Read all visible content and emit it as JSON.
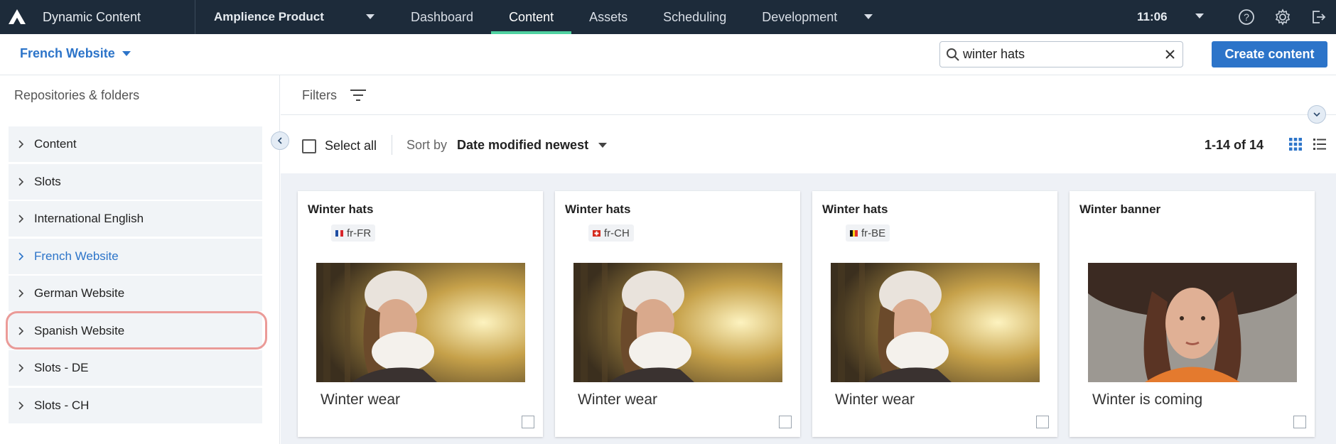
{
  "topbar": {
    "app_title": "Dynamic Content",
    "hub_name": "Amplience Product",
    "nav": [
      "Dashboard",
      "Content",
      "Assets",
      "Scheduling",
      "Development"
    ],
    "active_nav": "Content",
    "time": "11:06",
    "icons": [
      "amplience-logo-icon",
      "help-icon",
      "settings-gear-icon",
      "logout-icon"
    ]
  },
  "subbar": {
    "hub_select": "French Website",
    "search_value": "winter hats",
    "create_label": "Create content"
  },
  "sidebar": {
    "heading": "Repositories & folders",
    "items": [
      {
        "label": "Content"
      },
      {
        "label": "Slots"
      },
      {
        "label": "International English"
      },
      {
        "label": "French Website"
      },
      {
        "label": "German Website"
      },
      {
        "label": "Spanish Website"
      },
      {
        "label": "Slots - DE"
      },
      {
        "label": "Slots - CH"
      }
    ],
    "active_item": "French Website"
  },
  "main": {
    "filters_label": "Filters",
    "select_all": "Select all",
    "sort_label": "Sort by",
    "sort_value": "Date modified newest",
    "count": "1-14 of 14"
  },
  "cards": [
    {
      "title": "Winter hats",
      "locale": "fr-FR",
      "name": "Winter wear",
      "image": "woman-winter-hat-photo"
    },
    {
      "title": "Winter hats",
      "locale": "fr-CH",
      "name": "Winter wear",
      "image": "woman-winter-hat-photo"
    },
    {
      "title": "Winter hats",
      "locale": "fr-BE",
      "name": "Winter wear",
      "image": "woman-winter-hat-photo"
    },
    {
      "title": "Winter banner",
      "name": "Winter is coming",
      "image": "woman-brown-hat-photo"
    }
  ],
  "colors": {
    "topbar_bg": "#1d2b3a",
    "accent_blue": "#2c74c9",
    "active_tab_underline": "#4fd1a1",
    "highlight_ring": "#e88a86"
  }
}
